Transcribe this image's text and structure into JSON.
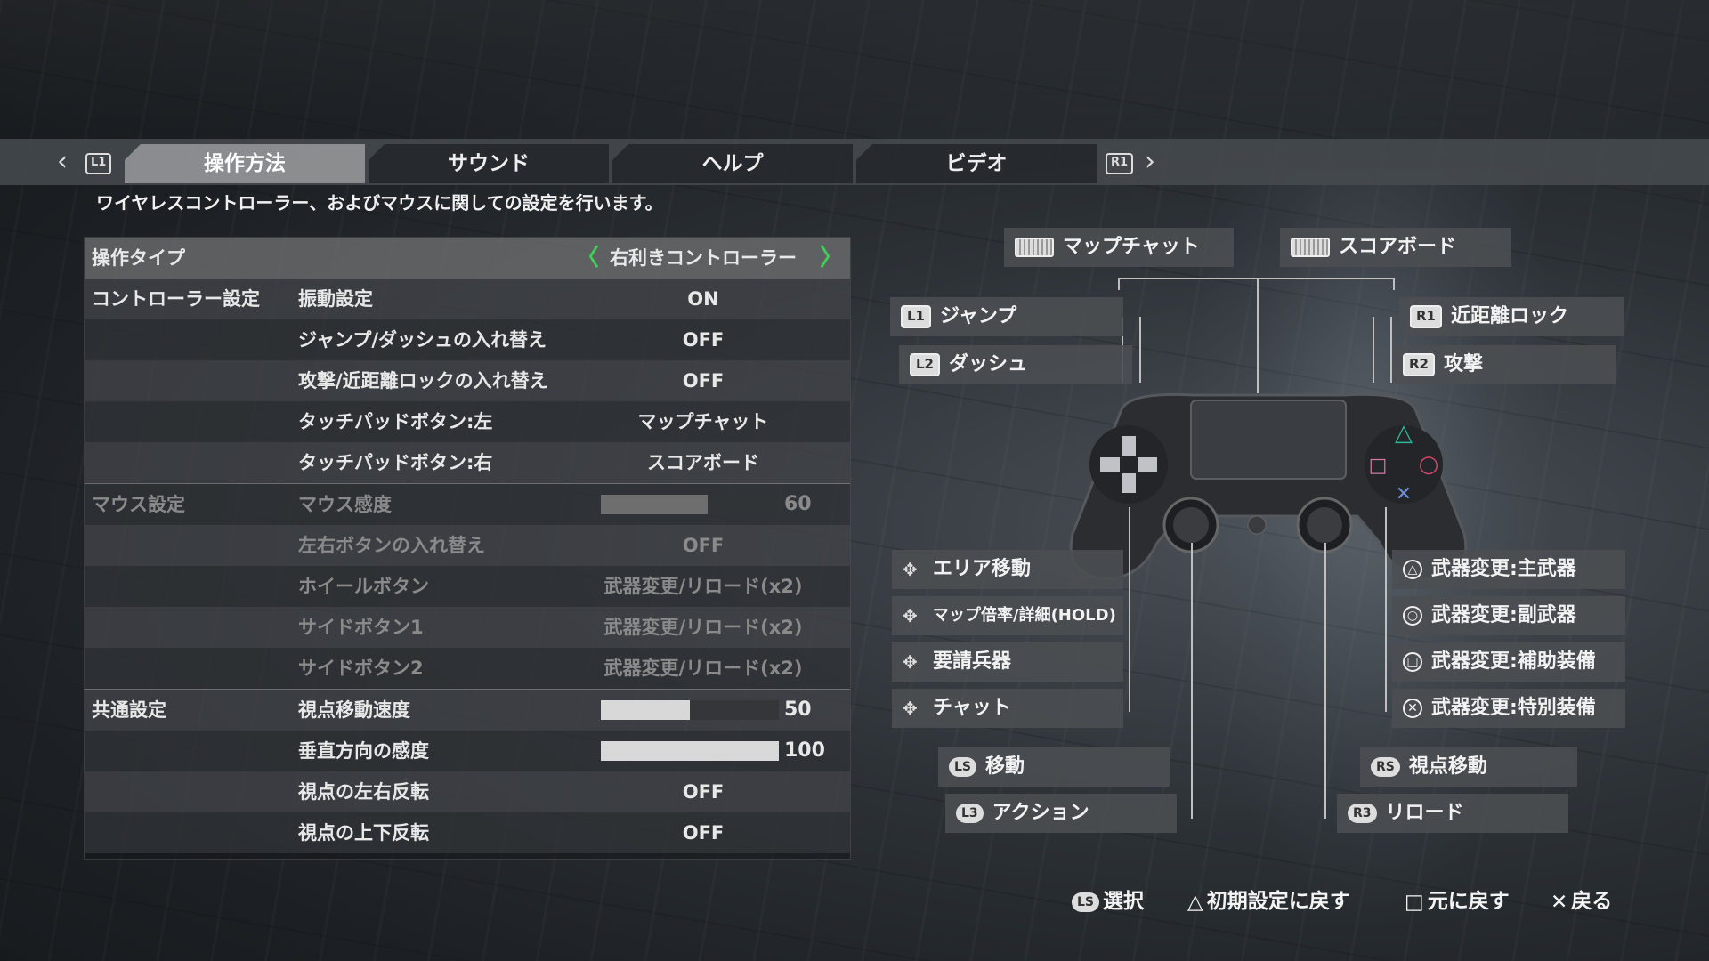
{
  "tabs": {
    "prev": "‹",
    "l1": "L1",
    "r1": "R1",
    "next": "›",
    "items": [
      {
        "label": "操作方法"
      },
      {
        "label": "サウンド"
      },
      {
        "label": "ヘルプ"
      },
      {
        "label": "ビデオ"
      }
    ]
  },
  "description": "ワイヤレスコントローラー、およびマウスに関しての設定を行います。",
  "settings": {
    "header": {
      "label": "操作タイプ",
      "value": "右利きコントローラー",
      "arrow_left": "〈",
      "arrow_right": "〉"
    },
    "controller": {
      "category": "コントローラー設定",
      "rows": [
        {
          "label": "振動設定",
          "value": "ON"
        },
        {
          "label": "ジャンプ/ダッシュの入れ替え",
          "value": "OFF"
        },
        {
          "label": "攻撃/近距離ロックの入れ替え",
          "value": "OFF"
        },
        {
          "label": "タッチパッドボタン:左",
          "value": "マップチャット"
        },
        {
          "label": "タッチパッドボタン:右",
          "value": "スコアボード"
        }
      ]
    },
    "mouse": {
      "category": "マウス設定",
      "sensitivity": {
        "label": "マウス感度",
        "value": "60",
        "fraction": 0.6
      },
      "rows": [
        {
          "label": "左右ボタンの入れ替え",
          "value": "OFF"
        },
        {
          "label": "ホイールボタン",
          "value": "武器変更/リロード(x2)"
        },
        {
          "label": "サイドボタン1",
          "value": "武器変更/リロード(x2)"
        },
        {
          "label": "サイドボタン2",
          "value": "武器変更/リロード(x2)"
        }
      ]
    },
    "common": {
      "category": "共通設定",
      "camera_speed": {
        "label": "視点移動速度",
        "value": "50",
        "fraction": 0.5
      },
      "vertical_sens": {
        "label": "垂直方向の感度",
        "value": "100",
        "fraction": 1.0
      },
      "rows": [
        {
          "label": "視点の左右反転",
          "value": "OFF"
        },
        {
          "label": "視点の上下反転",
          "value": "OFF"
        }
      ]
    }
  },
  "controller_map": {
    "touchpad_left": "マップチャット",
    "touchpad_right": "スコアボード",
    "l1": {
      "glyph": "L1",
      "label": "ジャンプ"
    },
    "l2": {
      "glyph": "L2",
      "label": "ダッシュ"
    },
    "r1": {
      "glyph": "R1",
      "label": "近距離ロック"
    },
    "r2": {
      "glyph": "R2",
      "label": "攻撃"
    },
    "dpad": [
      {
        "label": "エリア移動"
      },
      {
        "label": "マップ倍率/詳細(HOLD)"
      },
      {
        "label": "要請兵器"
      },
      {
        "label": "チャット"
      }
    ],
    "face": [
      {
        "glyph": "△",
        "label": "武器変更:主武器"
      },
      {
        "glyph": "○",
        "label": "武器変更:副武器"
      },
      {
        "glyph": "□",
        "label": "武器変更:補助装備"
      },
      {
        "glyph": "✕",
        "label": "武器変更:特別装備"
      }
    ],
    "ls": {
      "glyph": "LS",
      "label": "移動"
    },
    "l3": {
      "glyph": "L3",
      "label": "アクション"
    },
    "rs": {
      "glyph": "RS",
      "label": "視点移動"
    },
    "r3": {
      "glyph": "R3",
      "label": "リロード"
    }
  },
  "footer": [
    {
      "glyph": "LS",
      "label": "選択"
    },
    {
      "glyph": "△",
      "label": "初期設定に戻す"
    },
    {
      "glyph": "□",
      "label": "元に戻す"
    },
    {
      "glyph": "✕",
      "label": "戻る"
    }
  ],
  "colors": {
    "accent": "#3fd15a",
    "triangle": "#2fb59a",
    "circle": "#d6456a",
    "square": "#d07aa8",
    "cross": "#6f8fd8"
  }
}
